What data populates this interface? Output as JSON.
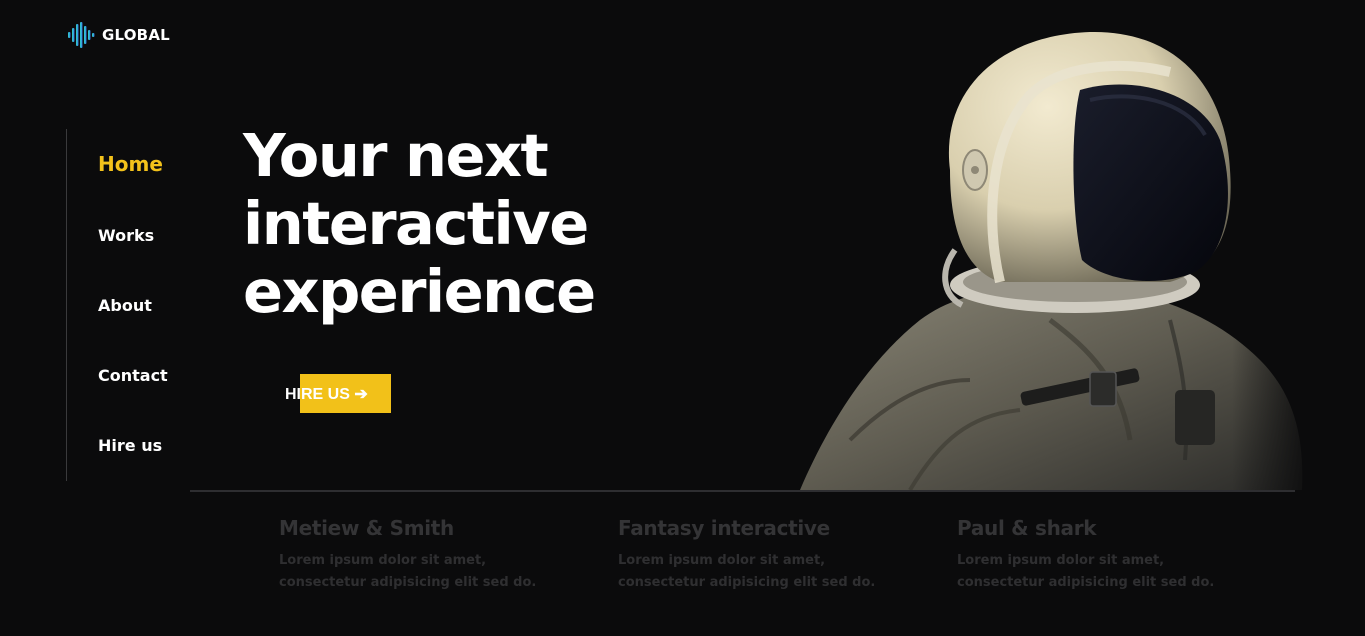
{
  "brand": {
    "name": "GLOBAL",
    "accent": "#f3c21b",
    "logo_colors": [
      "#2dd4bf",
      "#3b82f6"
    ]
  },
  "nav": {
    "items": [
      {
        "label": "Home",
        "active": true
      },
      {
        "label": "Works",
        "active": false
      },
      {
        "label": "About",
        "active": false
      },
      {
        "label": "Contact",
        "active": false
      },
      {
        "label": "Hire us",
        "active": false
      }
    ]
  },
  "hero": {
    "title_lines": [
      "Your next",
      "interactive",
      "experience"
    ],
    "cta_label": "HIRE US",
    "cta_icon": "arrow-right-icon",
    "image": "astronaut-illustration"
  },
  "cards": [
    {
      "title": "Metiew & Smith",
      "text": "Lorem ipsum dolor sit amet, consectetur adipisicing elit sed do."
    },
    {
      "title": "Fantasy interactive",
      "text": "Lorem ipsum dolor sit amet, consectetur adipisicing elit sed do."
    },
    {
      "title": "Paul & shark",
      "text": "Lorem ipsum dolor sit amet, consectetur adipisicing elit sed do."
    }
  ]
}
